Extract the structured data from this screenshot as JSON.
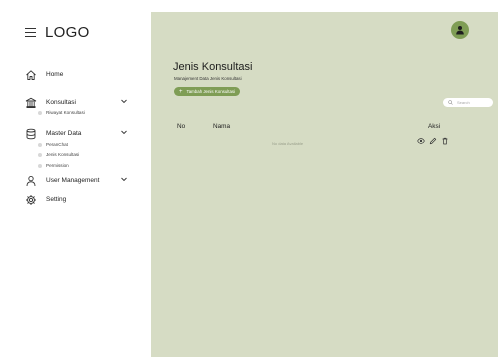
{
  "brand": {
    "logo": "LOGO"
  },
  "sidebar": {
    "items": [
      {
        "label": "Home",
        "icon": "home-icon"
      },
      {
        "label": "Konsultasi",
        "icon": "bank-icon",
        "expanded": true,
        "children": [
          {
            "label": "Riwayat Konsultasi"
          }
        ]
      },
      {
        "label": "Master Data",
        "icon": "database-icon",
        "expanded": true,
        "children": [
          {
            "label": "PeranChat"
          },
          {
            "label": "Jenis Konsultasi"
          },
          {
            "label": "Permission"
          }
        ]
      },
      {
        "label": "User Management",
        "icon": "user-icon",
        "expanded": false,
        "children": []
      },
      {
        "label": "Setting",
        "icon": "gear-icon"
      }
    ]
  },
  "main": {
    "title": "Jenis Konsultasi",
    "subtitle": "Manajement Data Jenis Konsultasi",
    "add_button": "Tambah Jenis Konsultasi",
    "search_placeholder": "Search",
    "table": {
      "columns": [
        "No",
        "Nama",
        "Aksi"
      ],
      "empty_message": "No data Available",
      "row_actions": [
        "view-icon",
        "edit-icon",
        "delete-icon"
      ]
    }
  },
  "colors": {
    "accent": "#7f9d55",
    "content_bg": "#d6dcc4",
    "sidebar_bg": "#ffffff"
  }
}
